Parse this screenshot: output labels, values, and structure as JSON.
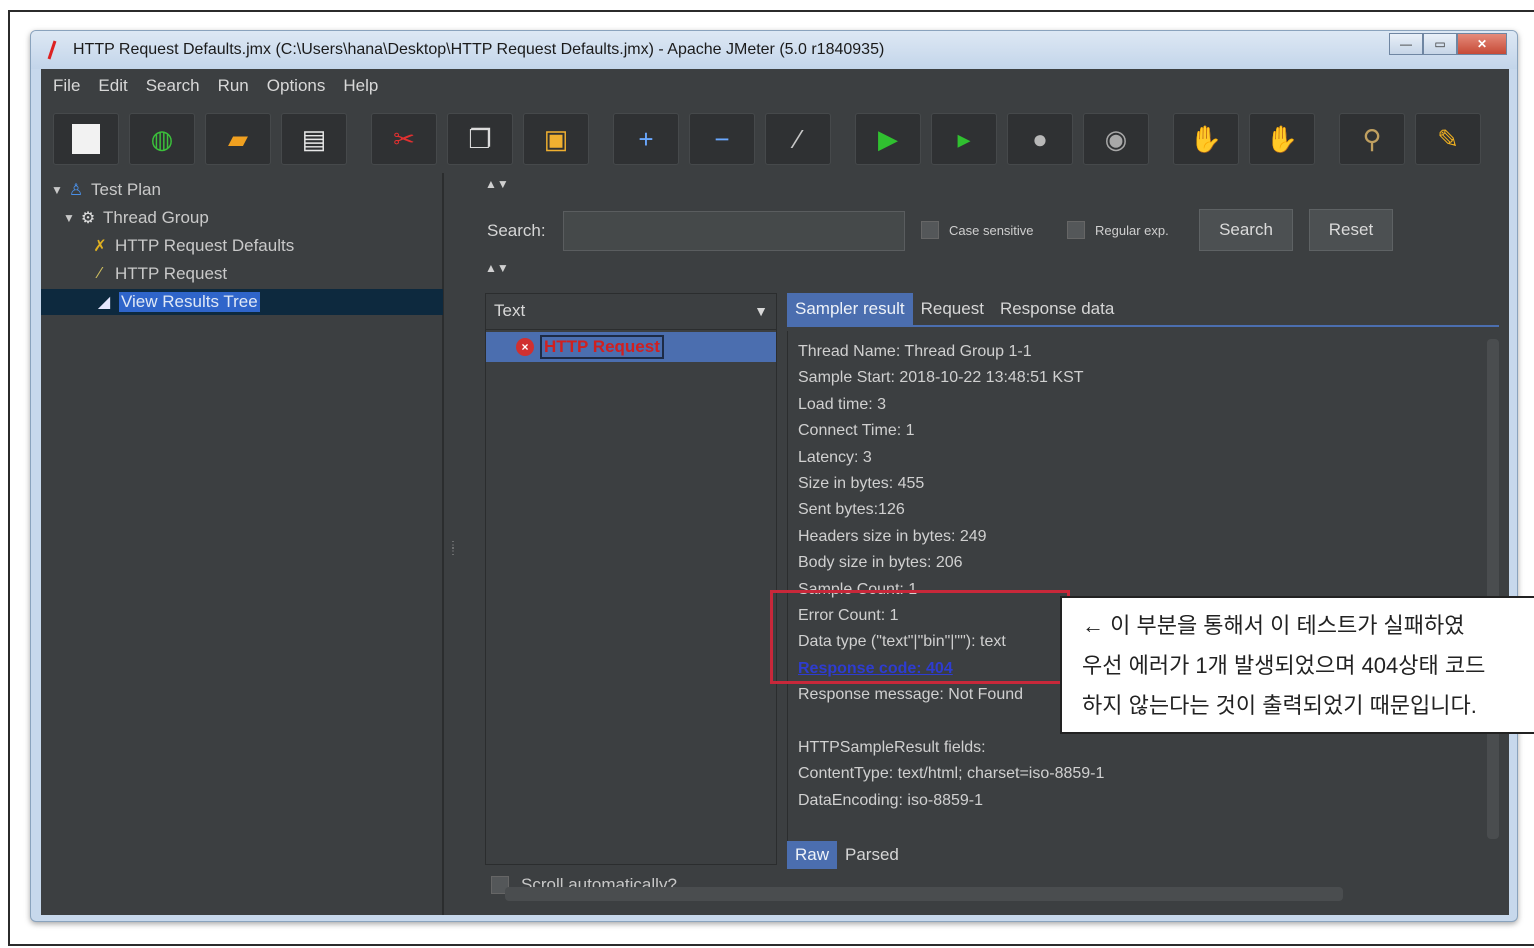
{
  "window": {
    "title": "HTTP Request Defaults.jmx (C:\\Users\\hana\\Desktop\\HTTP Request Defaults.jmx) - Apache JMeter (5.0 r1840935)",
    "controls": [
      "minimize",
      "maximize",
      "close"
    ]
  },
  "menu": [
    "File",
    "Edit",
    "Search",
    "Run",
    "Options",
    "Help"
  ],
  "toolbar": [
    {
      "icon": "new-icon"
    },
    {
      "icon": "templates-icon"
    },
    {
      "icon": "open-icon"
    },
    {
      "icon": "save-icon"
    },
    {
      "icon": "cut-icon"
    },
    {
      "icon": "copy-icon"
    },
    {
      "icon": "paste-icon"
    },
    {
      "icon": "expand-icon"
    },
    {
      "icon": "collapse-icon"
    },
    {
      "icon": "toggle-icon"
    },
    {
      "icon": "start-icon"
    },
    {
      "icon": "start-no-pauses-icon"
    },
    {
      "icon": "stop-icon"
    },
    {
      "icon": "shutdown-icon"
    },
    {
      "icon": "clear-icon"
    },
    {
      "icon": "clear-all-icon"
    },
    {
      "icon": "search-icon"
    },
    {
      "icon": "reset-search-icon"
    }
  ],
  "tree": [
    {
      "label": "Test Plan",
      "icon": "flask-icon"
    },
    {
      "label": "Thread Group",
      "icon": "gear-icon"
    },
    {
      "label": "HTTP Request Defaults",
      "icon": "wrench-icon"
    },
    {
      "label": "HTTP Request",
      "icon": "pencil-icon"
    },
    {
      "label": "View Results Tree",
      "icon": "chart-icon",
      "selected": true
    }
  ],
  "search": {
    "label": "Search:",
    "value": "",
    "case_sensitive": "Case sensitive",
    "regular_exp": "Regular exp.",
    "search_button": "Search",
    "reset_button": "Reset"
  },
  "results": {
    "header": "Text",
    "items": [
      {
        "label": "HTTP Request",
        "status": "error"
      }
    ],
    "scroll_auto": "Scroll automatically?"
  },
  "detail": {
    "tabs": [
      "Sampler result",
      "Request",
      "Response data"
    ],
    "lines": [
      "Thread Name: Thread Group 1-1",
      "Sample Start: 2018-10-22 13:48:51 KST",
      "Load time: 3",
      "Connect Time: 1",
      "Latency: 3",
      "Size in bytes: 455",
      "Sent bytes:126",
      "Headers size in bytes: 249",
      "Body size in bytes: 206",
      "Sample Count: 1",
      "Error Count: 1",
      "Data type (\"text\"|\"bin\"|\"\"): text",
      "Response code: 404",
      "Response message: Not Found",
      "",
      "HTTPSampleResult fields:",
      "ContentType: text/html; charset=iso-8859-1",
      "DataEncoding: iso-8859-1"
    ],
    "bottom_tabs": [
      "Raw",
      "Parsed"
    ]
  },
  "annotation": {
    "lines": [
      "← 이 부분을 통해서 이 테스트가 실패하였",
      "우선 에러가 1개 발생되었으며 404상태 코드",
      "하지 않는다는 것이 출력되었기 때문입니다."
    ]
  },
  "colors": {
    "app_bg": "#3c3f41",
    "selection": "#4b6eaf",
    "error_red": "#d02020",
    "highlight_box": "#c8283a"
  }
}
